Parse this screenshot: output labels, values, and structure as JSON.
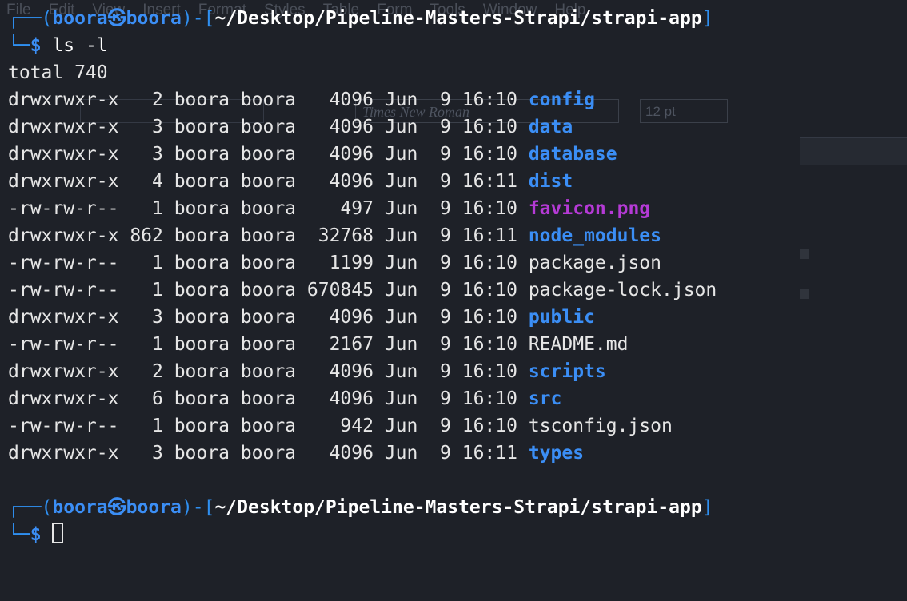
{
  "background_app": {
    "menu": [
      "File",
      "Edit",
      "View",
      "Insert",
      "Format",
      "Styles",
      "Table",
      "Form",
      "Tools",
      "Window",
      "Help"
    ],
    "font_name": "Times New Roman",
    "font_size": "12 pt"
  },
  "terminal": {
    "prompt": {
      "frame_open": "┌──(",
      "user": "boora",
      "at_symbol": "㉿",
      "host": "boora",
      "frame_mid": ")-[",
      "path": "~/Desktop/Pipeline-Masters-Strapi/strapi-app",
      "frame_close": "]",
      "prompt_prefix": "└─",
      "dollar": "$"
    },
    "command": "ls -l",
    "total_line": "total 740",
    "entries": [
      {
        "meta": "drwxrwxr-x   2 boora boora   4096 Jun  9 16:10 ",
        "name": "config",
        "kind": "dir"
      },
      {
        "meta": "drwxrwxr-x   3 boora boora   4096 Jun  9 16:10 ",
        "name": "data",
        "kind": "dir"
      },
      {
        "meta": "drwxrwxr-x   3 boora boora   4096 Jun  9 16:10 ",
        "name": "database",
        "kind": "dir"
      },
      {
        "meta": "drwxrwxr-x   4 boora boora   4096 Jun  9 16:11 ",
        "name": "dist",
        "kind": "dir"
      },
      {
        "meta": "-rw-rw-r--   1 boora boora    497 Jun  9 16:10 ",
        "name": "favicon.png",
        "kind": "image"
      },
      {
        "meta": "drwxrwxr-x 862 boora boora  32768 Jun  9 16:11 ",
        "name": "node_modules",
        "kind": "dir"
      },
      {
        "meta": "-rw-rw-r--   1 boora boora   1199 Jun  9 16:10 ",
        "name": "package.json",
        "kind": "file"
      },
      {
        "meta": "-rw-rw-r--   1 boora boora 670845 Jun  9 16:10 ",
        "name": "package-lock.json",
        "kind": "file"
      },
      {
        "meta": "drwxrwxr-x   3 boora boora   4096 Jun  9 16:10 ",
        "name": "public",
        "kind": "dir"
      },
      {
        "meta": "-rw-rw-r--   1 boora boora   2167 Jun  9 16:10 ",
        "name": "README.md",
        "kind": "file"
      },
      {
        "meta": "drwxrwxr-x   2 boora boora   4096 Jun  9 16:10 ",
        "name": "scripts",
        "kind": "dir"
      },
      {
        "meta": "drwxrwxr-x   6 boora boora   4096 Jun  9 16:10 ",
        "name": "src",
        "kind": "dir"
      },
      {
        "meta": "-rw-rw-r--   1 boora boora    942 Jun  9 16:10 ",
        "name": "tsconfig.json",
        "kind": "file"
      },
      {
        "meta": "drwxrwxr-x   3 boora boora   4096 Jun  9 16:11 ",
        "name": "types",
        "kind": "dir"
      }
    ]
  }
}
